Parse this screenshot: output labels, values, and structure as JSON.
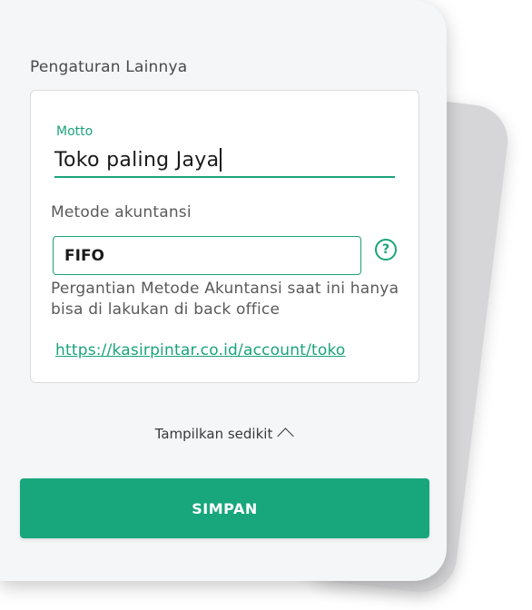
{
  "section": {
    "title": "Pengaturan Lainnya"
  },
  "motto": {
    "label": "Motto",
    "value": "Toko paling Jaya"
  },
  "metode": {
    "label": "Metode akuntansi",
    "value": "FIFO",
    "help_glyph": "?",
    "note": "Pergantian Metode Akuntansi saat ini hanya bisa di lakukan di back office",
    "link": "https://kasirpintar.co.id/account/toko"
  },
  "toggle": {
    "label": "Tampilkan sedikit"
  },
  "actions": {
    "save_label": "SIMPAN"
  },
  "colors": {
    "accent": "#1aa37a",
    "button": "#18a67c",
    "background": "#f4f6f7"
  }
}
